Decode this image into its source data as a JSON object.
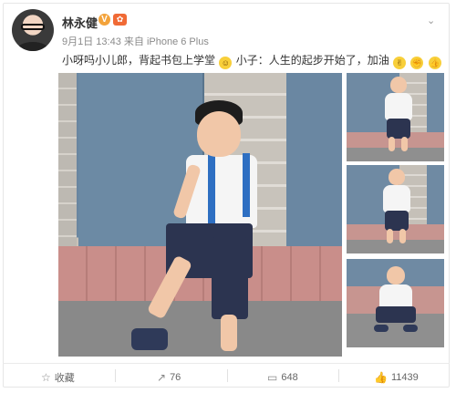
{
  "post": {
    "author": "林永健",
    "verified_badge": "V",
    "member_badge": "✿",
    "timestamp": "9月1日 13:43",
    "source_prefix": "来自",
    "source": "iPhone 6 Plus",
    "text_part1": "小呀吗小儿郎，背起书包上学堂",
    "text_part2": "小子：人生的起步开始了，加油",
    "emoji_1": "smiling-face",
    "emoji_2": "victory-hand",
    "emoji_3": "fist",
    "emoji_4": "thumbs-up"
  },
  "actions": {
    "favorite_label": "收藏",
    "repost_count": "76",
    "comment_count": "648",
    "like_count": "11439"
  },
  "colors": {
    "link": "#eb7350",
    "text": "#333333",
    "meta": "#8a8a8a"
  }
}
